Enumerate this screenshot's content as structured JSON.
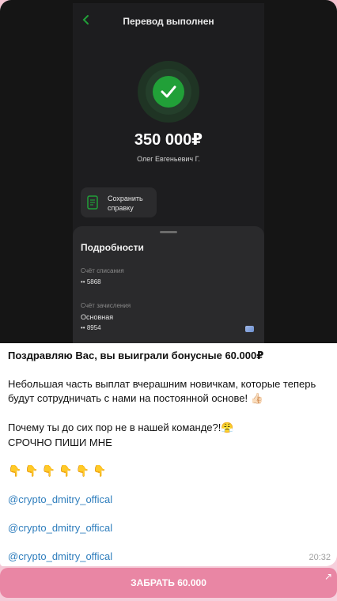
{
  "screenshot": {
    "title": "Перевод выполнен",
    "amount": "350 000₽",
    "recipient": "Олег Евгеньевич Г.",
    "save_button": "Сохранить справку",
    "details_title": "Подробности",
    "debit_label": "Счёт списания",
    "debit_value": "•• 5868",
    "credit_label": "Счёт зачисления",
    "credit_name": "Основная",
    "credit_value": "•• 8954",
    "accent": "#21a038"
  },
  "message": {
    "headline": "Поздравляю Вас, вы выиграли бонусные 60.000₽",
    "para1": "Небольшая часть выплат вчерашним новичкам, которые теперь будут сотрудничать с нами на постоянной основе!",
    "para1_emoji": "👍🏻",
    "question": "Почему ты до сих пор не в нашей команде?!",
    "question_emoji": "😤",
    "urgent": "СРОЧНО ПИШИ МНЕ",
    "hands": "👇👇👇👇👇👇",
    "link1": "@crypto_dmitry_offical",
    "link2": "@crypto_dmitry_offical",
    "link3": "@crypto_dmitry_offical",
    "time": "20:32"
  },
  "button": {
    "label": "ЗАБРАТЬ 60.000",
    "icon": "external-link-arrow-icon",
    "color": "#e986a4"
  }
}
